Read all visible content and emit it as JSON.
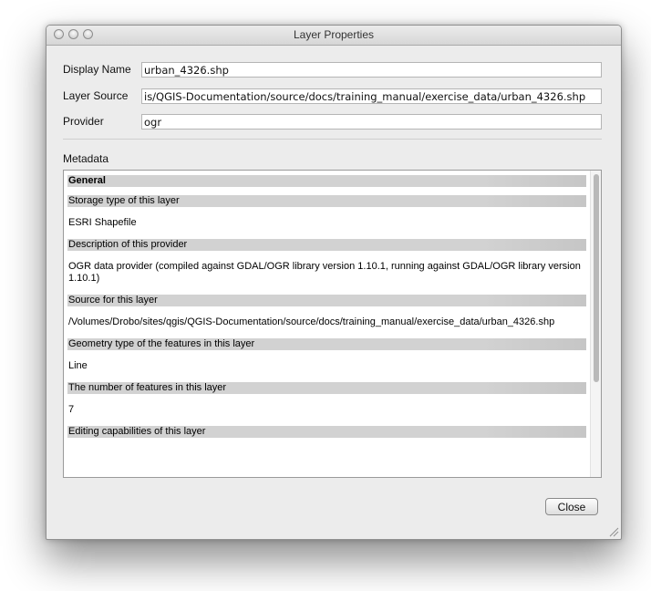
{
  "window": {
    "title": "Layer Properties",
    "controls": [
      "close-button",
      "minimize-button",
      "zoom-button"
    ]
  },
  "fields": {
    "display_name_label": "Display Name",
    "display_name_value": "urban_4326.shp",
    "layer_source_label": "Layer Source",
    "layer_source_value": "is/QGIS-Documentation/source/docs/training_manual/exercise_data/urban_4326.shp",
    "provider_label": "Provider",
    "provider_value": "ogr"
  },
  "metadata": {
    "label": "Metadata",
    "general": "General",
    "sections": [
      {
        "title": "Storage type of this layer",
        "value": "ESRI Shapefile"
      },
      {
        "title": "Description of this provider",
        "value": "OGR data provider (compiled against GDAL/OGR library version 1.10.1, running against GDAL/OGR library version 1.10.1)"
      },
      {
        "title": "Source for this layer",
        "value": "/Volumes/Drobo/sites/qgis/QGIS-Documentation/source/docs/training_manual/exercise_data/urban_4326.shp"
      },
      {
        "title": "Geometry type of the features in this layer",
        "value": "Line"
      },
      {
        "title": "The number of features in this layer",
        "value": "7"
      },
      {
        "title": "Editing capabilities of this layer",
        "value": ""
      }
    ]
  },
  "buttons": {
    "close": "Close"
  }
}
